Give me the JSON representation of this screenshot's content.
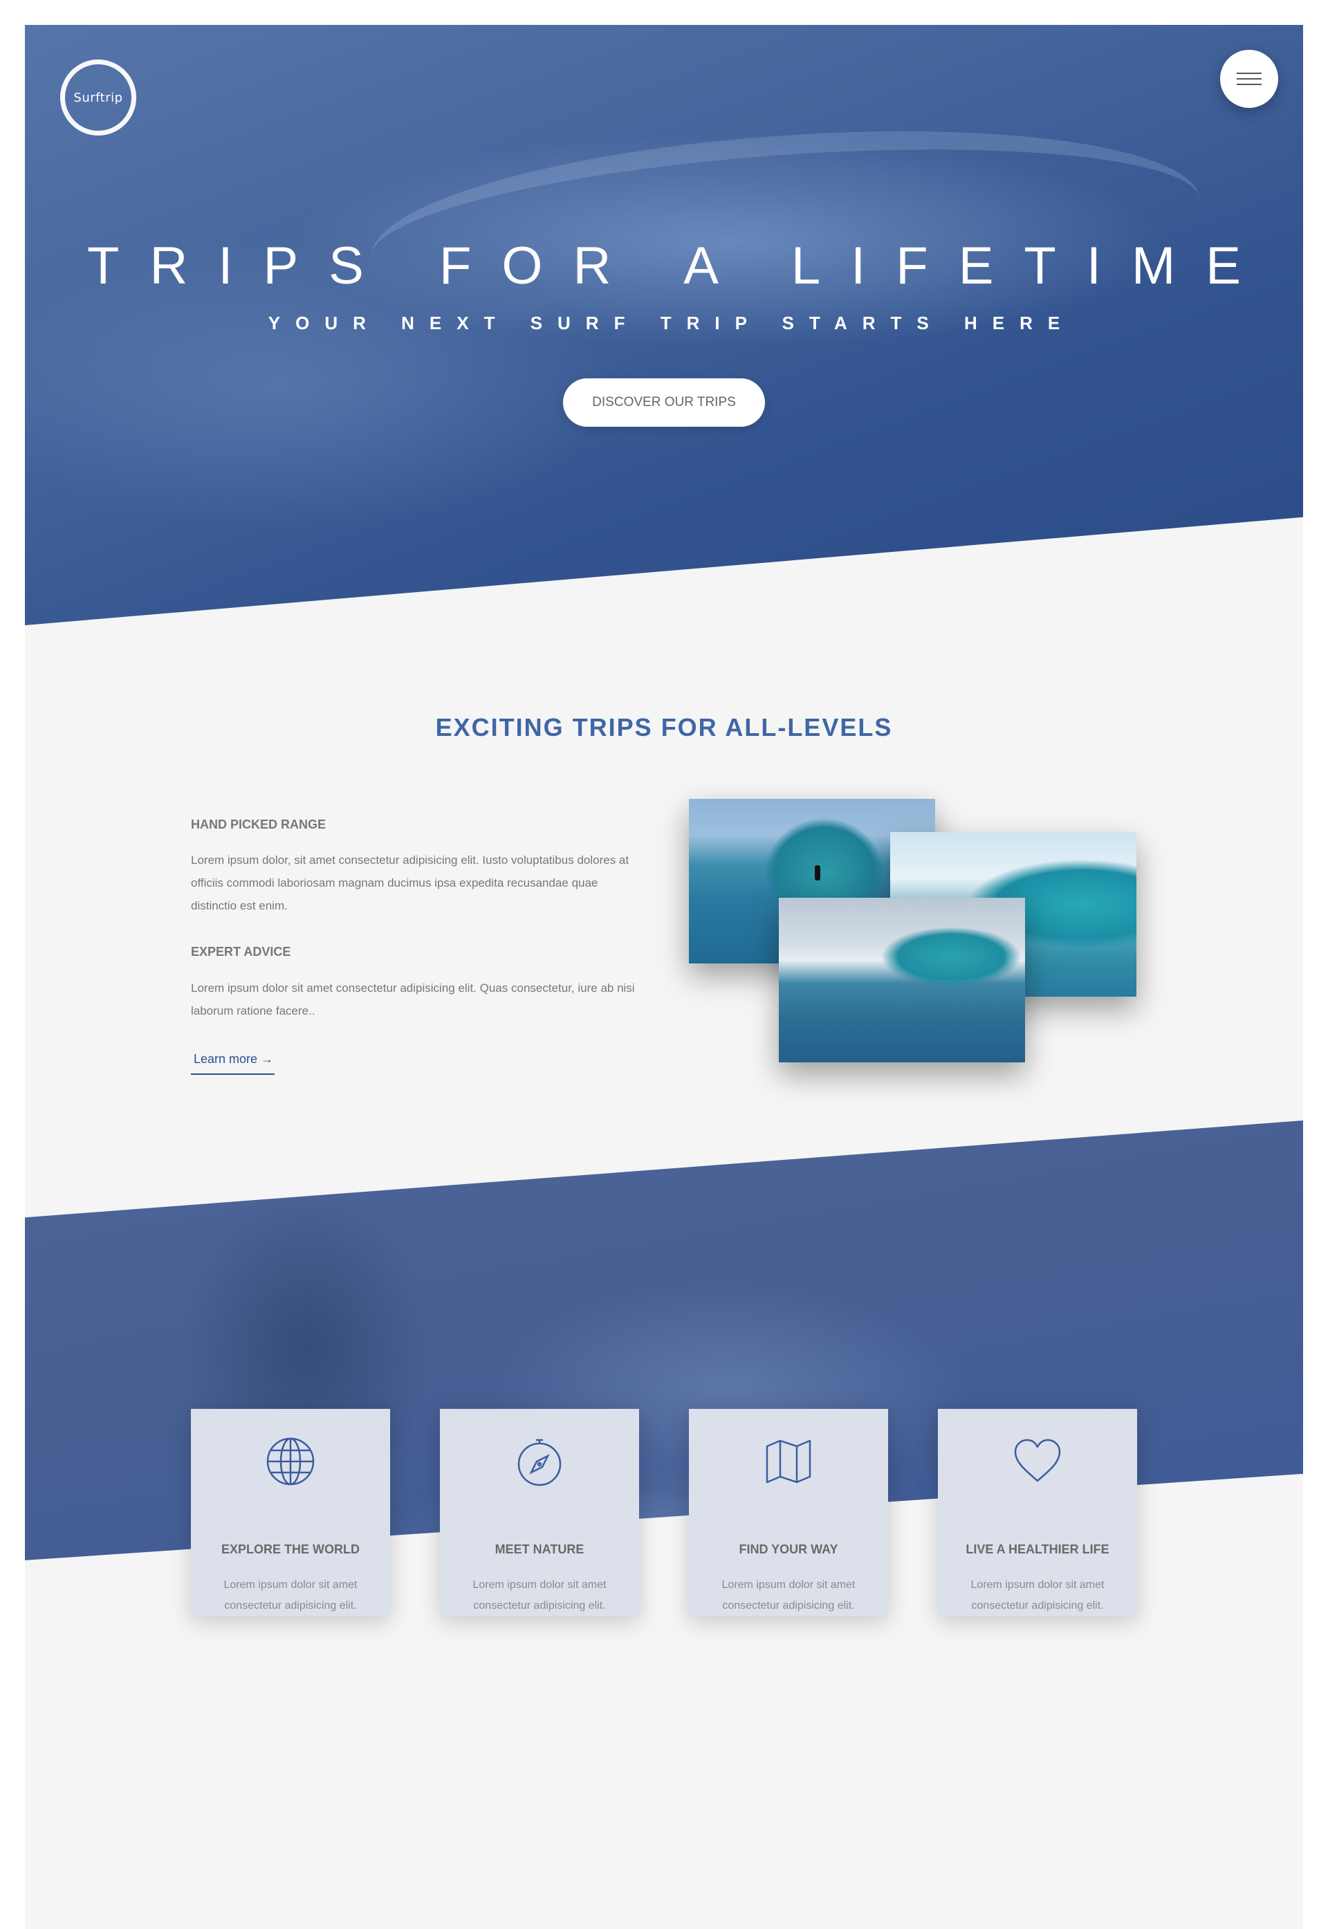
{
  "brand": {
    "logo_text": "Surftrip"
  },
  "hero": {
    "title": "TRIPS FOR A LIFETIME",
    "subtitle": "YOUR NEXT SURF TRIP STARTS HERE",
    "cta_label": "DISCOVER OUR TRIPS"
  },
  "about": {
    "title": "EXCITING TRIPS FOR ALL-LEVELS",
    "features": [
      {
        "heading": "HAND PICKED RANGE",
        "text": "Lorem ipsum dolor, sit amet consectetur adipisicing elit. Iusto voluptatibus dolores at officiis commodi laboriosam magnam ducimus ipsa expedita recusandae quae distinctio est enim."
      },
      {
        "heading": "EXPERT ADVICE",
        "text": "Lorem ipsum dolor sit amet consectetur adipisicing elit. Quas consectetur, iure ab nisi laborum ratione facere.."
      }
    ],
    "learn_more_label": "Learn more →"
  },
  "cards": [
    {
      "icon": "globe-icon",
      "title": "EXPLORE THE WORLD",
      "text": "Lorem ipsum dolor sit amet consectetur adipisicing elit."
    },
    {
      "icon": "compass-icon",
      "title": "MEET NATURE",
      "text": "Lorem ipsum dolor sit amet consectetur adipisicing elit."
    },
    {
      "icon": "map-icon",
      "title": "FIND YOUR WAY",
      "text": "Lorem ipsum dolor sit amet consectetur adipisicing elit."
    },
    {
      "icon": "heart-icon",
      "title": "LIVE A HEALTHIER LIFE",
      "text": "Lorem ipsum dolor sit amet consectetur adipisicing elit."
    }
  ],
  "colors": {
    "primary": "#3f66a6",
    "hero_blue": "#2a4b87",
    "page_bg": "#f5f5f5",
    "card_bg": "#dce0ea"
  }
}
